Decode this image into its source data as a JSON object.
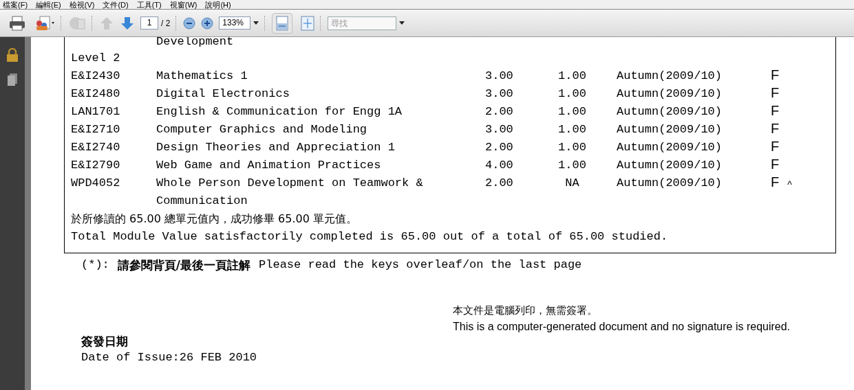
{
  "menu": [
    "檔案(F)",
    "編輯(E)",
    "檢視(V)",
    "文件(D)",
    "工具(T)",
    "視窗(W)",
    "說明(H)"
  ],
  "toolbar": {
    "page_current": "1",
    "page_total": "/ 2",
    "zoom": "133%",
    "find_placeholder": "尋找",
    "fit_width_selected": true
  },
  "document": {
    "cut_line": "Development",
    "level": "Level 2",
    "modules": [
      {
        "code": "E&I2430",
        "title": [
          "Mathematics 1"
        ],
        "credits": "3.00",
        "factor": "1.00",
        "term": "Autumn(2009/10)",
        "grade": "F"
      },
      {
        "code": "E&I2480",
        "title": [
          "Digital Electronics"
        ],
        "credits": "3.00",
        "factor": "1.00",
        "term": "Autumn(2009/10)",
        "grade": "F"
      },
      {
        "code": "LAN1701",
        "title": [
          "English & Communication for Engg 1A"
        ],
        "credits": "2.00",
        "factor": "1.00",
        "term": "Autumn(2009/10)",
        "grade": "F"
      },
      {
        "code": "E&I2710",
        "title": [
          "Computer Graphics and Modeling"
        ],
        "credits": "3.00",
        "factor": "1.00",
        "term": "Autumn(2009/10)",
        "grade": "F"
      },
      {
        "code": "E&I2740",
        "title": [
          "Design Theories and Appreciation 1"
        ],
        "credits": "2.00",
        "factor": "1.00",
        "term": "Autumn(2009/10)",
        "grade": "F"
      },
      {
        "code": "E&I2790",
        "title": [
          "Web Game and Animation Practices"
        ],
        "credits": "4.00",
        "factor": "1.00",
        "term": "Autumn(2009/10)",
        "grade": "F"
      },
      {
        "code": "WPD4052",
        "title": [
          "Whole Person Development on Teamwork &",
          "Communication"
        ],
        "credits": "2.00",
        "factor": "NA",
        "term": "Autumn(2009/10)",
        "grade": "F",
        "note": "^"
      }
    ],
    "summary_zh": "於所修讀的 65.00 總單元值內，成功修畢 65.00 單元值。",
    "summary_en": "Total Module Value satisfactorily completed is 65.00 out of a total of 65.00 studied.",
    "footnote_mark": "(*):",
    "footnote_zh": "請參閱背頁/最後一頁註解",
    "footnote_en": "Please read the keys overleaf/on the last page",
    "computer_note_zh": "本文件是電腦列印，無需簽署。",
    "computer_note_en": "This is a computer-generated document and no signature is required.",
    "issue_label_zh": "簽發日期",
    "issue_date": "Date of Issue:26 FEB 2010"
  }
}
